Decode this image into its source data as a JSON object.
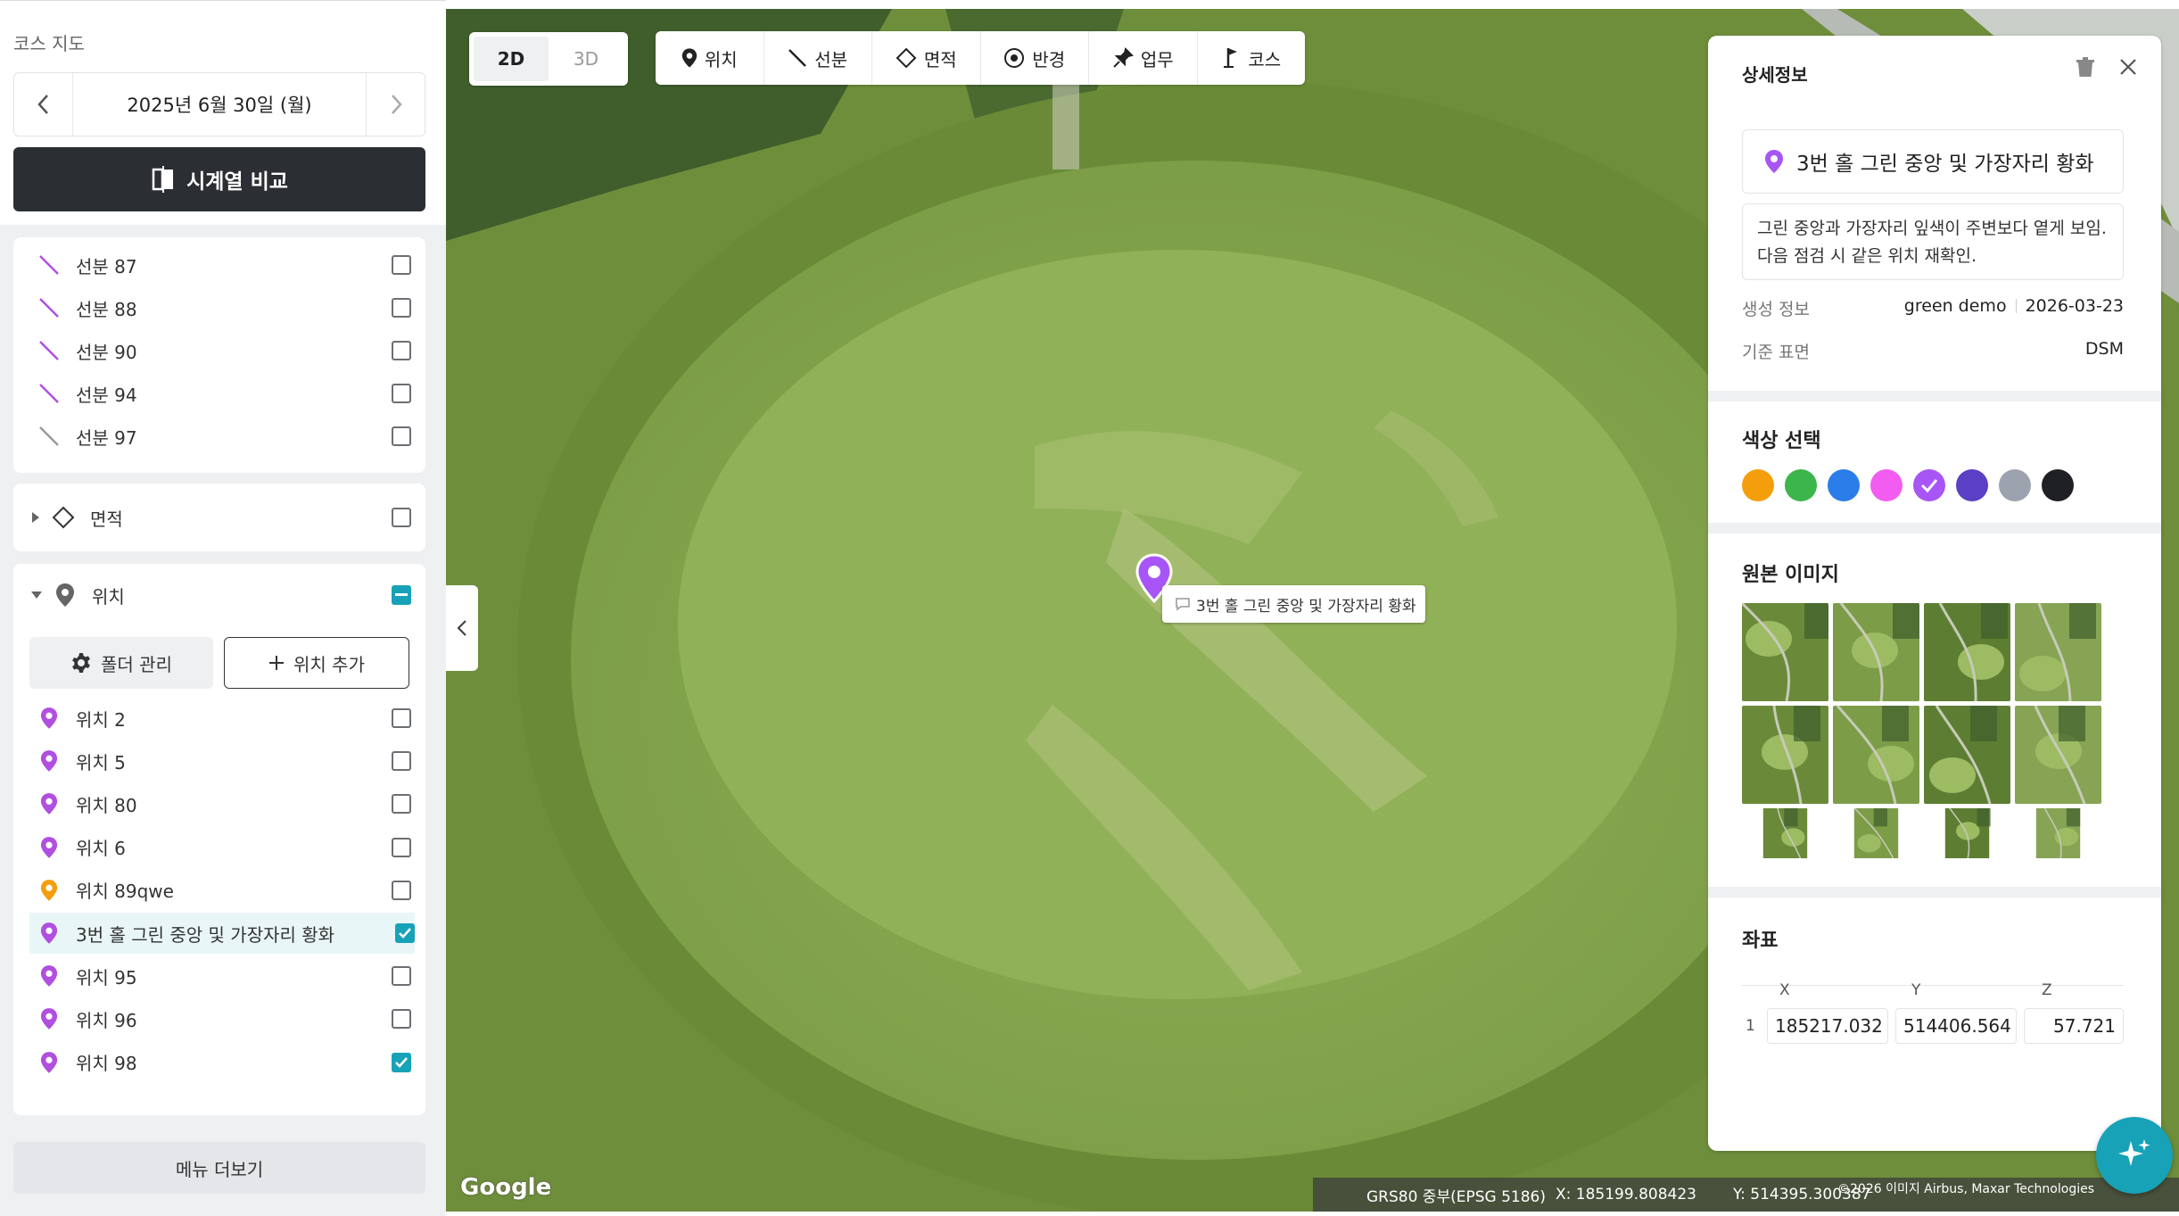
{
  "sidebar": {
    "title": "코스 지도",
    "date": "2025년 6월 30일 (월)",
    "compare_label": "시계열 비교",
    "segments": [
      {
        "label": "선분 87",
        "checked": false,
        "color": "#b04fe0"
      },
      {
        "label": "선분 88",
        "checked": false,
        "color": "#b04fe0"
      },
      {
        "label": "선분 90",
        "checked": false,
        "color": "#b04fe0"
      },
      {
        "label": "선분 94",
        "checked": false,
        "color": "#b04fe0"
      },
      {
        "label": "선분 97",
        "checked": false,
        "color": "#999999"
      }
    ],
    "area_section": {
      "label": "면적",
      "checked": false
    },
    "location_section": {
      "label": "위치",
      "state": "partial"
    },
    "folder_btn": "폴더 관리",
    "add_btn": "위치 추가",
    "locations": [
      {
        "label": "위치 2",
        "checked": false,
        "color": "#b04fe0"
      },
      {
        "label": "위치 5",
        "checked": false,
        "color": "#b04fe0"
      },
      {
        "label": "위치 80",
        "checked": false,
        "color": "#b04fe0"
      },
      {
        "label": "위치 6",
        "checked": false,
        "color": "#b04fe0"
      },
      {
        "label": "위치 89qwe",
        "checked": false,
        "color": "#f59e0b"
      },
      {
        "label": "3번 홀 그린 중앙 및 가장자리 황화",
        "checked": true,
        "color": "#b04fe0",
        "selected": true
      },
      {
        "label": "위치 95",
        "checked": false,
        "color": "#b04fe0"
      },
      {
        "label": "위치 96",
        "checked": false,
        "color": "#b04fe0"
      },
      {
        "label": "위치 98",
        "checked": true,
        "color": "#b04fe0"
      }
    ],
    "more_label": "메뉴 더보기"
  },
  "map": {
    "view_toggle": {
      "2d": "2D",
      "3d": "3D",
      "active": "2D"
    },
    "tools": [
      {
        "label": "위치",
        "icon": "pin-icon"
      },
      {
        "label": "선분",
        "icon": "line-icon"
      },
      {
        "label": "면적",
        "icon": "area-icon"
      },
      {
        "label": "반경",
        "icon": "radius-icon"
      },
      {
        "label": "업무",
        "icon": "task-pin-icon"
      },
      {
        "label": "코스",
        "icon": "flag-icon"
      }
    ],
    "marker_label": "3번 홀 그린 중앙 및 가장자리 황화",
    "google": "Google",
    "crs": "GRS80 중부(EPSG 5186)",
    "cursor_x": "X: 185199.808423",
    "cursor_y": "Y: 514395.300387",
    "copyright": "©2026 이미지 Airbus, Maxar Technologies"
  },
  "detail": {
    "title": "상세정보",
    "name": "3번 홀 그린 중앙 및 가장자리 황화",
    "memo": "그린 중앙과 가장자리 잎색이 주변보다 옅게 보임. 다음 점검 시 같은 위치 재확인.",
    "created_label": "생성 정보",
    "created_user": "green demo",
    "created_date": "2026-03-23",
    "surface_label": "기준 표면",
    "surface_value": "DSM",
    "color_title": "색상 선택",
    "colors": [
      "#f59e0b",
      "#3cb54a",
      "#2b7de9",
      "#f25cf0",
      "#a855f7",
      "#5b3fc4",
      "#9ca3af",
      "#1f2023"
    ],
    "selected_color": "#a855f7",
    "images_title": "원본 이미지",
    "coord_title": "좌표",
    "coord_headers": {
      "x": "X",
      "y": "Y",
      "z": "Z"
    },
    "coords": [
      {
        "index": "1",
        "x": "185217.032",
        "y": "514406.564",
        "z": "57.721"
      }
    ]
  }
}
